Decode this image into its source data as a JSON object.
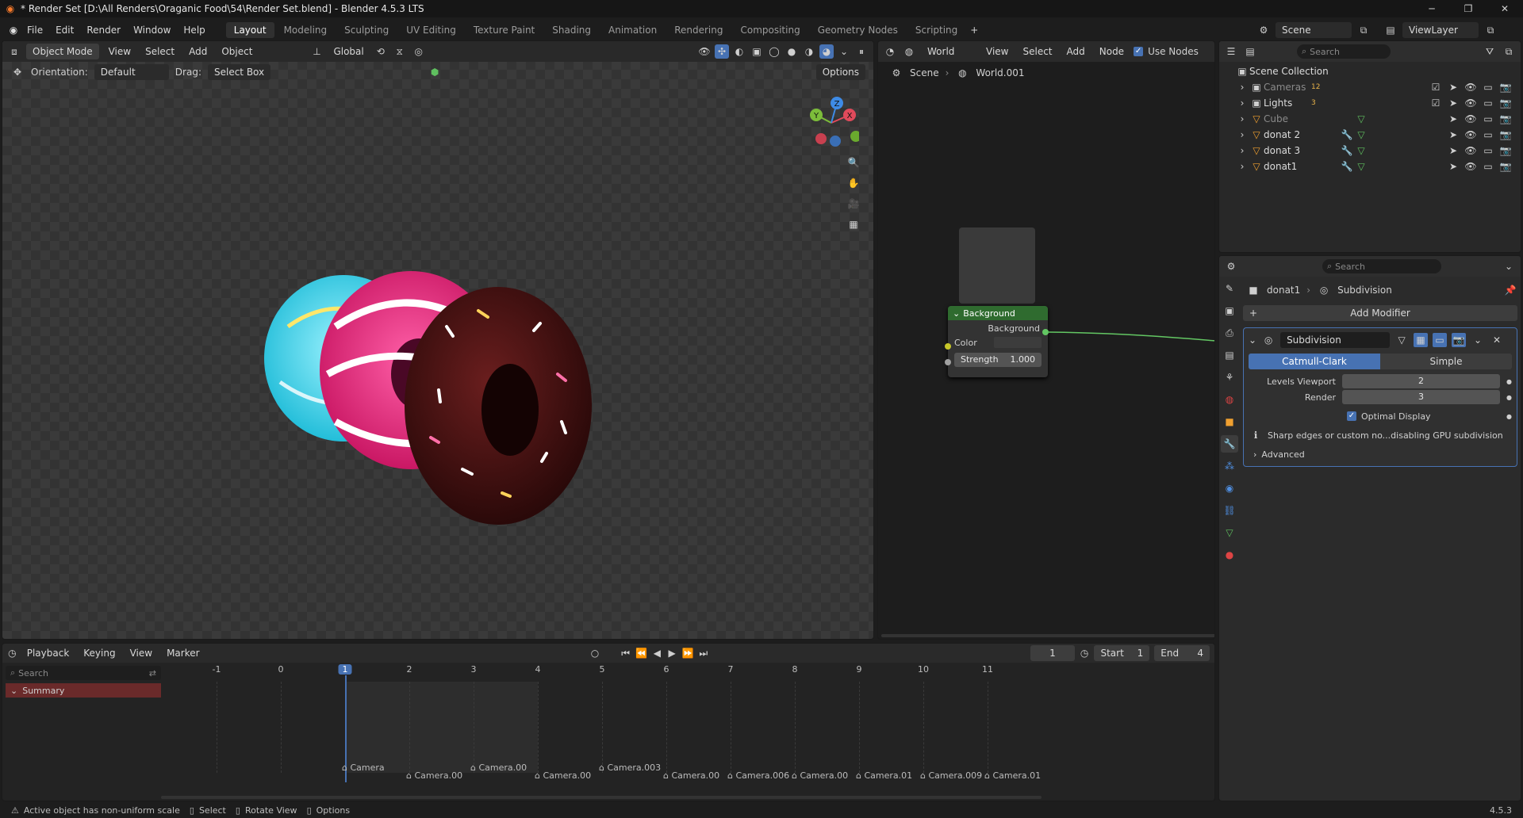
{
  "window": {
    "title": "* Render Set [D:\\All Renders\\Oraganic Food\\54\\Render Set.blend] - Blender 4.5.3 LTS"
  },
  "menu": [
    "File",
    "Edit",
    "Render",
    "Window",
    "Help"
  ],
  "workspaces": [
    "Layout",
    "Modeling",
    "Sculpting",
    "UV Editing",
    "Texture Paint",
    "Shading",
    "Animation",
    "Rendering",
    "Compositing",
    "Geometry Nodes",
    "Scripting"
  ],
  "active_workspace": "Layout",
  "scene_selector": "Scene",
  "viewlayer_selector": "ViewLayer",
  "viewport": {
    "mode": "Object Mode",
    "menus": [
      "View",
      "Select",
      "Add",
      "Object"
    ],
    "transform": "Global",
    "orientation_label": "Orientation:",
    "orientation_value": "Default",
    "drag_label": "Drag:",
    "drag_value": "Select Box",
    "options": "Options",
    "gizmo": {
      "x": "X",
      "y": "Y",
      "z": "Z"
    }
  },
  "node_editor": {
    "world_selector": "World",
    "menus": [
      "View",
      "Select",
      "Add",
      "Node"
    ],
    "use_nodes_label": "Use Nodes",
    "breadcrumb": [
      "Scene",
      "World.001"
    ],
    "node": {
      "title": "Background",
      "output": "Background",
      "color_label": "Color",
      "strength_label": "Strength",
      "strength_value": "1.000"
    }
  },
  "outliner": {
    "search_placeholder": "Search",
    "root": "Scene Collection",
    "items": [
      {
        "name": "Cameras",
        "badge": "12"
      },
      {
        "name": "Lights",
        "badge": "3"
      },
      {
        "name": "Cube",
        "badge": ""
      },
      {
        "name": "donat 2",
        "badge": ""
      },
      {
        "name": "donat 3",
        "badge": ""
      },
      {
        "name": "donat1",
        "badge": ""
      }
    ]
  },
  "properties": {
    "search_placeholder": "Search",
    "breadcrumb_object": "donat1",
    "breadcrumb_modifier": "Subdivision",
    "add_modifier": "Add Modifier",
    "modifier_name": "Subdivision",
    "type_a": "Catmull-Clark",
    "type_b": "Simple",
    "levels_viewport_label": "Levels Viewport",
    "levels_viewport_value": "2",
    "render_label": "Render",
    "render_value": "3",
    "optimal_display": "Optimal Display",
    "warning": "Sharp edges or custom no...disabling GPU subdivision",
    "advanced": "Advanced"
  },
  "timeline": {
    "menus": [
      "Playback",
      "Keying",
      "View",
      "Marker"
    ],
    "current_frame": "1",
    "start_label": "Start",
    "start_value": "1",
    "end_label": "End",
    "end_value": "4",
    "search_placeholder": "Search",
    "summary": "Summary",
    "ticks": [
      "-1",
      "0",
      "1",
      "2",
      "3",
      "4",
      "5",
      "6",
      "7",
      "8",
      "9",
      "10",
      "11"
    ],
    "markers": [
      "Camera",
      "Camera.00",
      "Camera.00",
      "Camera.00",
      "Camera.003",
      "Camera.00",
      "Camera.006",
      "Camera.00",
      "Camera.01",
      "Camera.009",
      "Camera.01"
    ]
  },
  "statusbar": {
    "warning": "Active object has non-uniform scale",
    "select": "Select",
    "rotate": "Rotate View",
    "options": "Options",
    "version": "4.5.3"
  },
  "colors": {
    "accent": "#4772b3",
    "node_header": "#2f6b2f",
    "summary_bg": "#6a2a2a"
  }
}
